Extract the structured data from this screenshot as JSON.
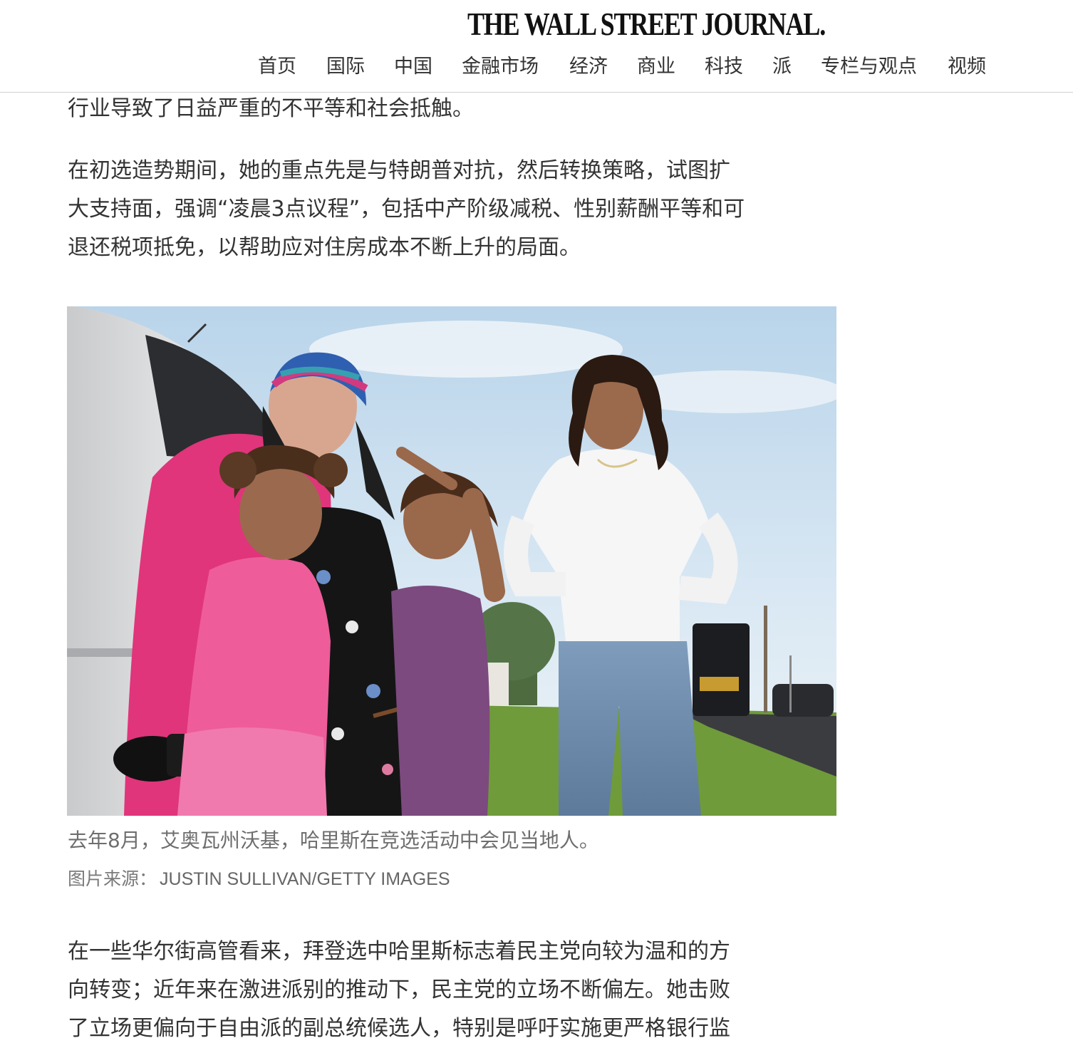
{
  "header": {
    "masthead": "THE WALL STREET JOURNAL.",
    "nav": [
      "首页",
      "国际",
      "中国",
      "金融市场",
      "经济",
      "商业",
      "科技",
      "派",
      "专栏与观点",
      "视频"
    ]
  },
  "article": {
    "para1": "行业导致了日益严重的不平等和社会抵触。",
    "para2_lines": [
      "在初选造势期间，她的重点先是与特朗普对抗，然后转换策略，试图扩",
      "大支持面，强调“凌晨3点议程”，包括中产阶级减税、性别薪酬平等和可",
      "退还税项抵免，以帮助应对住房成本不断上升的局面。"
    ],
    "image": {
      "caption": "去年8月，艾奥瓦州沃基，哈里斯在竞选活动中会见当地人。",
      "credit_label": "图片来源：",
      "credit_name": "JUSTIN SULLIVAN/GETTY IMAGES"
    },
    "para3_lines": [
      "在一些华尔街高管看来，拜登选中哈里斯标志着民主党向较为温和的方",
      "向转变；近年来在激进派别的推动下，民主党的立场不断偏左。她击败",
      "了立场更偏向于自由派的副总统候选人，特别是呼吁实施更严格银行监"
    ]
  }
}
